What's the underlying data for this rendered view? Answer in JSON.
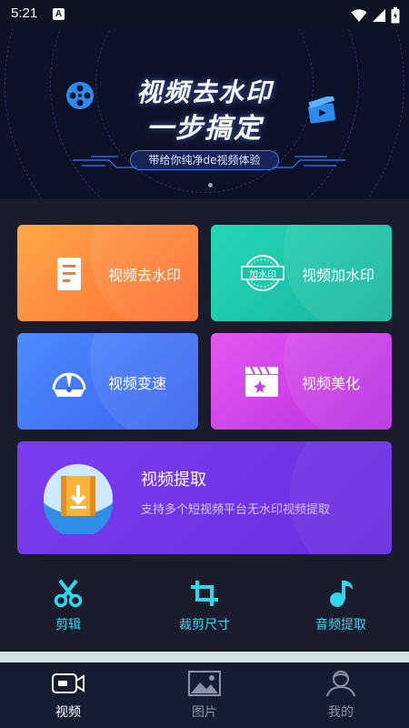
{
  "status_bar": {
    "time": "5:21",
    "indicator_letter": "A"
  },
  "banner": {
    "title_line1": "视频去水印",
    "title_line2": "一步搞定",
    "subtitle": "带给你纯净de视频体验"
  },
  "features": {
    "remove_watermark": "视频去水印",
    "add_watermark": "视频加水印",
    "add_watermark_stamp": "加水印",
    "speed": "视频变速",
    "beautify": "视频美化",
    "extract_title": "视频提取",
    "extract_desc": "支持多个短视频平台无水印视频提取"
  },
  "tools": {
    "cut": "剪辑",
    "crop": "裁剪尺寸",
    "audio": "音频提取"
  },
  "bottom_nav": {
    "video": "视频",
    "image": "图片",
    "mine": "我的"
  },
  "colors": {
    "active_tab": "#ffffff",
    "inactive_tab": "#8d93a6",
    "tool_accent": "#2fd7ee"
  }
}
